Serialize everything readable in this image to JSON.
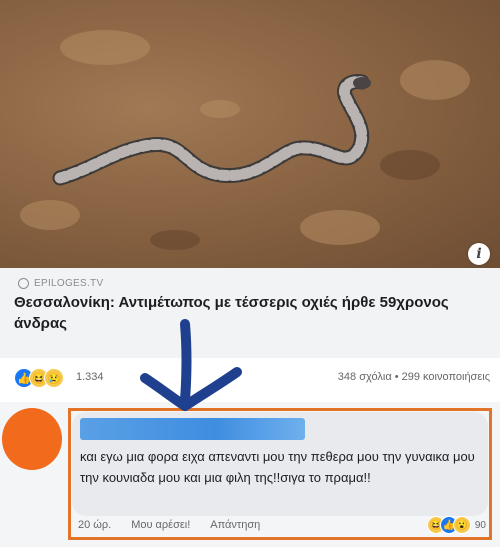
{
  "post": {
    "source": "EPILOGES.TV",
    "headline": "Θεσσαλονίκη: Αντιμέτωπος με τέσσερις οχιές ήρθε 59χρονος άνδρας",
    "info_glyph": "i",
    "reaction_count": "1.334",
    "stats": "348 σχόλια • 299 κοινοποιήσεις",
    "reaction_icons": [
      "like-icon",
      "haha-icon",
      "sad-icon"
    ]
  },
  "comment": {
    "text": "και εγω μια φορα ειχα απεναντι μου την πεθερα μου την γυναικα μου την κουνιαδα μου και μια φιλη της!!σιγα το πραμα!!",
    "time": "20 ώρ.",
    "like_label": "Μου αρέσει!",
    "reply_label": "Απάντηση",
    "reaction_count": "90",
    "reaction_icons": [
      "haha-icon",
      "like-icon",
      "surprised-icon"
    ]
  },
  "colors": {
    "annotation_orange": "#e2742a",
    "arrow_blue": "#1f3f8f",
    "redaction_blue": "#3f8de0",
    "facebook_blue": "#1877f2"
  }
}
